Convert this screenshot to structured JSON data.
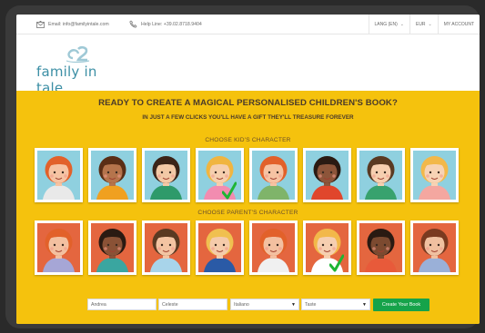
{
  "topbar": {
    "email": "Email: info@familyintale.com",
    "helpline": "Help Line: +39.02.8718.9404",
    "menus": [
      {
        "label": "LANG (EN)",
        "caret": "⌄"
      },
      {
        "label": "EUR",
        "caret": "⌄"
      },
      {
        "label": "MY ACCOUNT",
        "caret": ""
      }
    ]
  },
  "logo": {
    "text": "family in tale"
  },
  "hero": {
    "title": "READY TO CREATE A MAGICAL PERSONALISED CHILDREN'S BOOK?",
    "subtitle": "IN JUST A FEW CLICKS YOU'LL HAVE A GIFT THEY'LL TREASURE FOREVER",
    "kids_label": "CHOOSE KID'S CHARACTER",
    "parents_label": "CHOOSE PARENT'S CHARACTER"
  },
  "colors": {
    "banner": "#f5c20d",
    "accent_green": "#16a34a",
    "logo_blue": "#3c8fa5"
  },
  "kids": [
    {
      "bg": "#8fd0df",
      "hair": "#e2612a",
      "skin": "#f6c3a3",
      "shirt": "#e9e9e9",
      "selected": false
    },
    {
      "bg": "#8fd0df",
      "hair": "#5a2e16",
      "skin": "#b5744c",
      "shirt": "#f0a020",
      "selected": false
    },
    {
      "bg": "#8fd0df",
      "hair": "#3b2418",
      "skin": "#f3c9a6",
      "shirt": "#2e9a6a",
      "selected": false
    },
    {
      "bg": "#8fd0df",
      "hair": "#f0b540",
      "skin": "#f6cfae",
      "shirt": "#f28cb0",
      "selected": true
    },
    {
      "bg": "#8fd0df",
      "hair": "#e2612a",
      "skin": "#f6c3a3",
      "shirt": "#7fb46a",
      "selected": false
    },
    {
      "bg": "#8fd0df",
      "hair": "#2a1a12",
      "skin": "#8d553a",
      "shirt": "#e0462c",
      "selected": false
    },
    {
      "bg": "#8fd0df",
      "hair": "#5a3a22",
      "skin": "#f6cfb0",
      "shirt": "#38a26e",
      "selected": false
    },
    {
      "bg": "#8fd0df",
      "hair": "#f2b84a",
      "skin": "#f7d3b5",
      "shirt": "#f4a7a0",
      "selected": false
    }
  ],
  "parents": [
    {
      "bg": "#e4663f",
      "hair": "#e2612a",
      "skin": "#f3c0a0",
      "shirt": "#a6a6d6",
      "selected": false
    },
    {
      "bg": "#e4663f",
      "hair": "#2a1a12",
      "skin": "#8a5236",
      "shirt": "#3aa6a0",
      "selected": false
    },
    {
      "bg": "#e4663f",
      "hair": "#5a3a22",
      "skin": "#f3c4a2",
      "shirt": "#a8d4ea",
      "selected": false
    },
    {
      "bg": "#e4663f",
      "hair": "#f0c050",
      "skin": "#f5cbaa",
      "shirt": "#2a5aa6",
      "selected": false
    },
    {
      "bg": "#e4663f",
      "hair": "#e2612a",
      "skin": "#f3c0a0",
      "shirt": "#f0f0f0",
      "selected": false
    },
    {
      "bg": "#e4663f",
      "hair": "#f2b84a",
      "skin": "#f6cfb0",
      "shirt": "#ffffff",
      "selected": true
    },
    {
      "bg": "#e4663f",
      "hair": "#2a1a12",
      "skin": "#7c4a30",
      "shirt": "#e85a3a",
      "selected": false
    },
    {
      "bg": "#e4663f",
      "hair": "#7a3a20",
      "skin": "#f0c0a0",
      "shirt": "#9ab0d8",
      "selected": false
    }
  ],
  "form": {
    "name1": "Andrea",
    "name2": "Celeste",
    "language": "Italiano",
    "variant": "Taste",
    "cta": "Create Your Book"
  }
}
